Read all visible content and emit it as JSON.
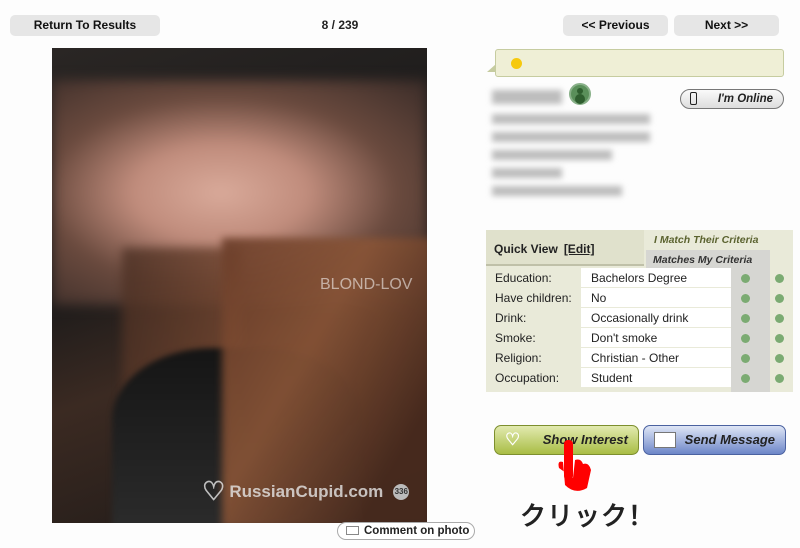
{
  "nav": {
    "return_label": "Return To Results",
    "counter": "8 / 239",
    "previous_label": "<< Previous",
    "next_label": "Next >>"
  },
  "photo": {
    "watermark_text": "BLOND-LOV",
    "brand_logo": "RussianCupid.com",
    "photo_badge": "336",
    "comment_label": "Comment on photo"
  },
  "profile": {
    "status_dot_color": "#f6c90e",
    "online_label": "I'm Online"
  },
  "quick_view": {
    "title": "Quick View",
    "edit_label": "[Edit]",
    "criteria_1": "I Match Their Criteria",
    "criteria_2": "Matches My Criteria",
    "rows": [
      {
        "label": "Education:",
        "value": "Bachelors Degree"
      },
      {
        "label": "Have children:",
        "value": "No"
      },
      {
        "label": "Drink:",
        "value": "Occasionally drink"
      },
      {
        "label": "Smoke:",
        "value": "Don't smoke"
      },
      {
        "label": "Religion:",
        "value": "Christian - Other"
      },
      {
        "label": "Occupation:",
        "value": "Student"
      }
    ]
  },
  "actions": {
    "show_interest_label": "Show Interest",
    "send_message_label": "Send Message"
  },
  "annotation": {
    "click_text": "クリック！"
  }
}
